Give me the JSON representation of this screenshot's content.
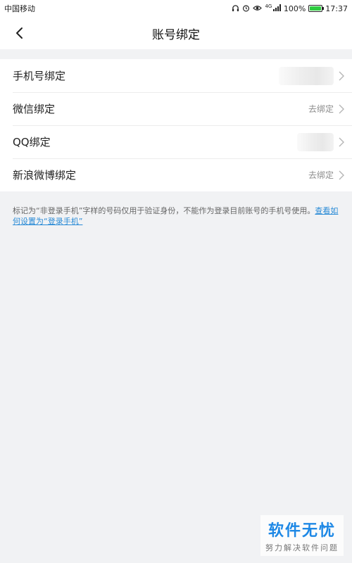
{
  "status_bar": {
    "carrier": "中国移动",
    "network": "4G",
    "battery": "100%",
    "time": "17:37",
    "icons": [
      "headset-icon",
      "alarm-icon",
      "eye-icon",
      "signal-icon",
      "battery-icon"
    ]
  },
  "header": {
    "title": "账号绑定",
    "back_icon": "chevron-left-icon"
  },
  "bindings": [
    {
      "label": "手机号绑定",
      "status": "",
      "redacted": true
    },
    {
      "label": "微信绑定",
      "status": "去绑定",
      "redacted": false
    },
    {
      "label": "QQ绑定",
      "status": "",
      "redacted": true
    },
    {
      "label": "新浪微博绑定",
      "status": "去绑定",
      "redacted": false
    }
  ],
  "note": {
    "text": "标记为“非登录手机”字样的号码仅用于验证身份，不能作为登录目前账号的手机号使用。",
    "link": "查看如何设置为“登录手机”"
  },
  "watermark": {
    "main": "软件无忧",
    "sub": "努力解决软件问题"
  },
  "colors": {
    "background": "#f1f2f4",
    "link": "#2a8bd6",
    "battery": "#2ecc40",
    "watermark": "#1e88e5"
  }
}
